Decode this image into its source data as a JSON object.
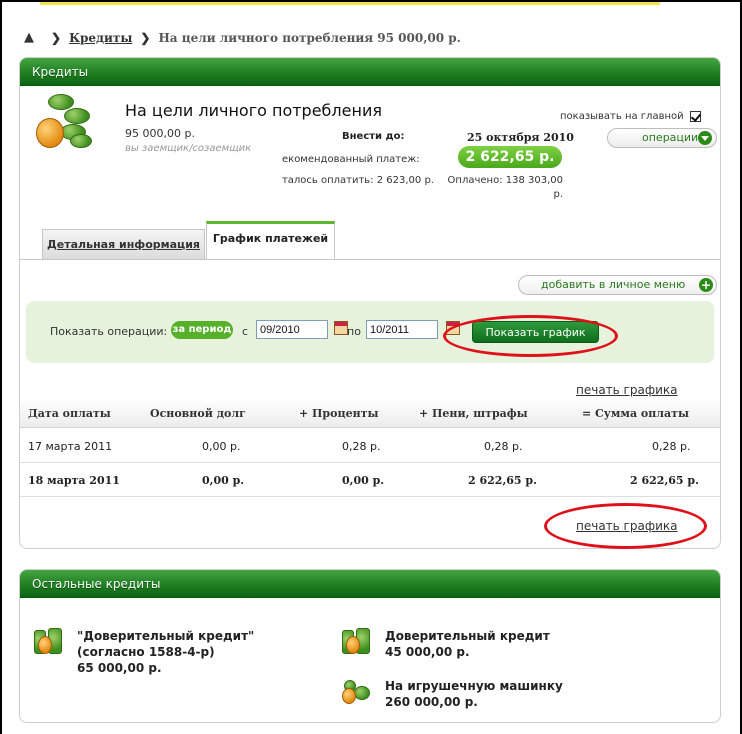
{
  "breadcrumb": {
    "link": "Кредиты",
    "current": "На цели личного потребления 95 000,00 р."
  },
  "loan_panel": {
    "header": "Кредиты",
    "title": "На цели личного потребления",
    "amount": "95 000,00 р.",
    "role": "вы заемщик/созаемщик",
    "show_on_main": "показывать на главной",
    "show_on_main_checked": true,
    "operations_label": "операции",
    "due_label": "Внести до:",
    "due_date": "25 октября 2010",
    "recommended_label": "екомендованный платеж:",
    "recommended_value": "2 622,65 р.",
    "remaining_label": "талось оплатить: 2 623,00 р.",
    "paid_label": "Оплачено: 138 303,00 р."
  },
  "tabs": [
    {
      "label": "Детальная информация",
      "active": false
    },
    {
      "label": "График платежей",
      "active": true
    }
  ],
  "add_menu_label": "добавить в личное меню",
  "filter": {
    "show_ops_label": "Показать операции:",
    "period_label": "за период",
    "from_label": "с",
    "from_value": "09/2010",
    "to_label": "по",
    "to_value": "10/2011",
    "show_button": "Показать график"
  },
  "print_label": "печать графика",
  "table": {
    "columns": [
      "Дата оплаты",
      "Основной долг",
      "+  Проценты",
      "+  Пени, штрафы",
      "=  Сумма оплаты"
    ],
    "rows": [
      {
        "date": "17 марта 2011",
        "principal": "0,00 р.",
        "interest": "0,28 р.",
        "fines": "0,28 р.",
        "total": "0,28 р.",
        "bold": false
      },
      {
        "date": "18 марта 2011",
        "principal": "0,00 р.",
        "interest": "0,00 р.",
        "fines": "2 622,65 р.",
        "total": "2 622,65 р.",
        "bold": true
      }
    ]
  },
  "other_loans": {
    "header": "Остальные кредиты",
    "items": [
      {
        "name": "\"Доверительный кредит\" (согласно 1588-4-р)",
        "amount": "65 000,00 р."
      },
      {
        "name": "Доверительный кредит",
        "amount": "45 000,00 р."
      },
      {
        "name": "На игрушечную машинку",
        "amount": "260 000,00 р."
      }
    ]
  },
  "colors": {
    "header_green": "#1f7f22",
    "accent_green": "#56b02a",
    "highlight_red": "#e0101a",
    "filter_bg": "#e6f2dc"
  }
}
